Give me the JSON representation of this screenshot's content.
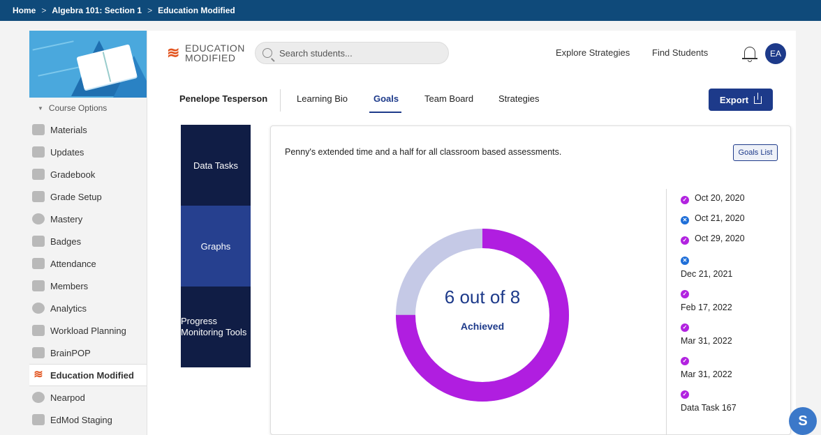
{
  "breadcrumb": {
    "home": "Home",
    "sep": ">",
    "course": "Algebra 101: Section 1",
    "current": "Education Modified"
  },
  "sidebar": {
    "course_options": "Course Options",
    "items": [
      {
        "label": "Materials",
        "icon": "materials-icon"
      },
      {
        "label": "Updates",
        "icon": "updates-icon"
      },
      {
        "label": "Gradebook",
        "icon": "gradebook-icon"
      },
      {
        "label": "Grade Setup",
        "icon": "grade-setup-icon"
      },
      {
        "label": "Mastery",
        "icon": "mastery-icon"
      },
      {
        "label": "Badges",
        "icon": "badges-icon"
      },
      {
        "label": "Attendance",
        "icon": "attendance-icon"
      },
      {
        "label": "Members",
        "icon": "members-icon"
      },
      {
        "label": "Analytics",
        "icon": "analytics-icon"
      },
      {
        "label": "Workload Planning",
        "icon": "workload-icon"
      },
      {
        "label": "BrainPOP",
        "icon": "brainpop-icon"
      },
      {
        "label": "Education Modified",
        "icon": "education-modified-icon",
        "active": true
      },
      {
        "label": "Nearpod",
        "icon": "nearpod-icon"
      },
      {
        "label": "EdMod Staging",
        "icon": "edmod-icon"
      }
    ]
  },
  "header": {
    "logo_line1": "EDUCATION",
    "logo_line2": "MODIFIED",
    "search_placeholder": "Search students...",
    "explore": "Explore Strategies",
    "find": "Find Students",
    "avatar": "EA"
  },
  "tabs": {
    "student": "Penelope Tesperson",
    "items": [
      "Learning Bio",
      "Goals",
      "Team Board",
      "Strategies"
    ],
    "export": "Export"
  },
  "tasks": [
    "Data Tasks",
    "Graphs",
    "Progress Monitoring Tools"
  ],
  "goal": {
    "text": "Penny's extended time and a half for all classroom based assessments.",
    "goals_list": "Goals List",
    "donut_big": "6 out of 8",
    "donut_small": "Achieved",
    "achieved": 6,
    "total": 8,
    "colors": {
      "achieved": "#b01ee0",
      "remaining": "#c5c9e6"
    }
  },
  "log": [
    {
      "status": "ok",
      "label": "Oct 20, 2020"
    },
    {
      "status": "no",
      "label": "Oct 21, 2020"
    },
    {
      "status": "ok",
      "label": "Oct 29, 2020"
    },
    {
      "status": "no",
      "label": "Dec 21, 2021"
    },
    {
      "status": "ok",
      "label": "Feb 17, 2022"
    },
    {
      "status": "ok",
      "label": "Mar 31, 2022"
    },
    {
      "status": "ok",
      "label": "Mar 31, 2022"
    },
    {
      "status": "ok",
      "label": "Data Task 167"
    }
  ],
  "fab": "S"
}
